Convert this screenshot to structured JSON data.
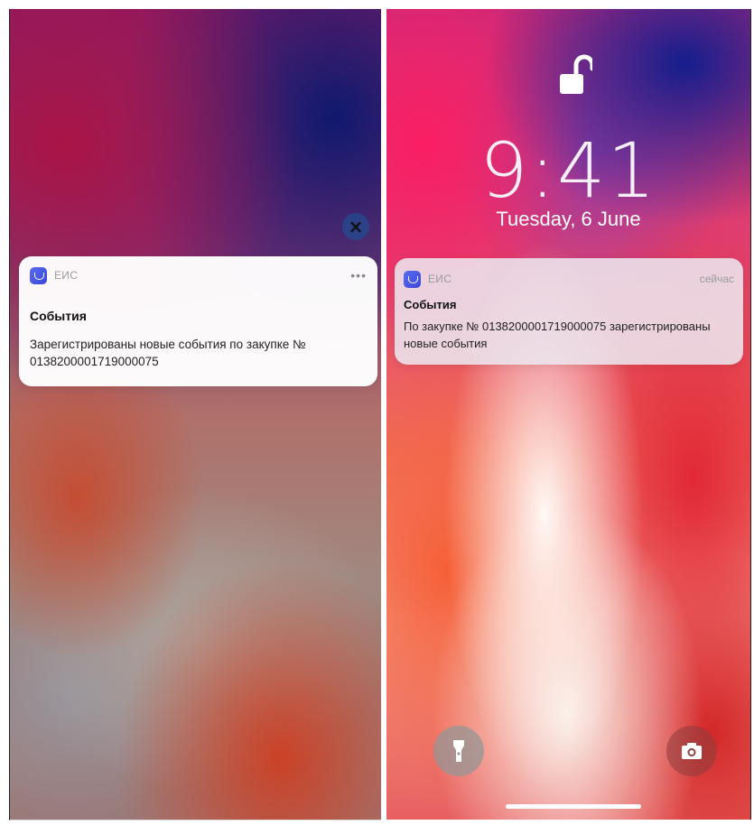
{
  "left_screen": {
    "notification": {
      "app_name": "ЕИС",
      "more_label": "•••",
      "title": "События",
      "body": "Зарегистрированы новые события по закупке № 0138200001719000075"
    },
    "close_label": "×"
  },
  "right_screen": {
    "time": "9:41",
    "date": "Tuesday, 6 June",
    "notification": {
      "app_name": "ЕИС",
      "time_label": "сейчас",
      "title": "События",
      "body": "По закупке № 0138200001719000075 зарегистрированы новые события"
    }
  },
  "icons": {
    "app_icon": "eis-app-icon",
    "lock": "unlocked-padlock-icon",
    "flashlight": "flashlight-icon",
    "camera": "camera-icon",
    "close": "close-icon",
    "more": "more-dots-icon"
  },
  "colors": {
    "app_icon": "#4a5ae8",
    "close_button": "#28468c",
    "notification_bg": "#ffffff"
  }
}
